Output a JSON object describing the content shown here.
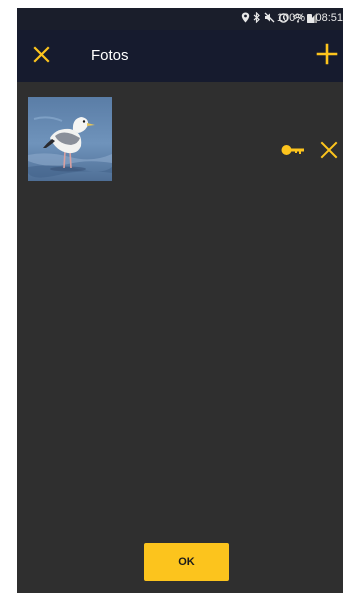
{
  "status_bar": {
    "battery": "100%",
    "time": "08:51",
    "icons": [
      "location-icon",
      "bluetooth-icon",
      "mute-icon",
      "alarm-icon",
      "wifi-icon",
      "signal-icon",
      "battery-icon"
    ]
  },
  "app_bar": {
    "title": "Fotos",
    "close_icon": "close-icon",
    "add_icon": "add-icon"
  },
  "photos": [
    {
      "subject": "gull-photo",
      "key_icon": "key-icon",
      "remove_icon": "close-icon"
    }
  ],
  "footer": {
    "ok_label": "OK"
  },
  "colors": {
    "accent": "#fcc41d",
    "app_bar": "#161b2e",
    "status_bar": "#1a1e2b",
    "background": "#2f2f2f"
  }
}
